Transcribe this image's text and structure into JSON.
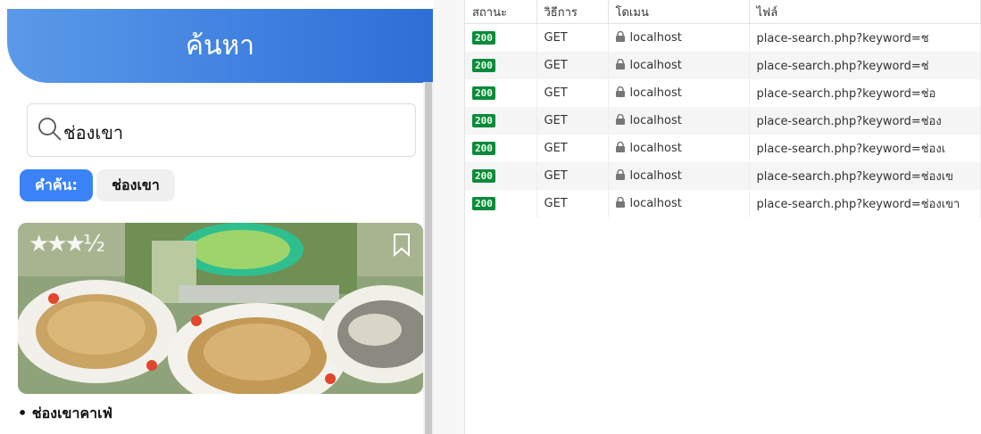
{
  "app": {
    "header_title": "ค้นหา",
    "search_value": "ช่องเขา",
    "chip_label": "คำค้น:",
    "chip_value": "ช่องเขา",
    "rating_stars": "★★★½",
    "place_name": "• ช่องเขาคาเฟ่"
  },
  "network": {
    "columns": [
      "สถานะ",
      "วิธีการ",
      "โดเมน",
      "ไฟล์"
    ],
    "rows": [
      {
        "status": "200",
        "method": "GET",
        "domain": "localhost",
        "file": "place-search.php?keyword=ช"
      },
      {
        "status": "200",
        "method": "GET",
        "domain": "localhost",
        "file": "place-search.php?keyword=ช่"
      },
      {
        "status": "200",
        "method": "GET",
        "domain": "localhost",
        "file": "place-search.php?keyword=ช่อ"
      },
      {
        "status": "200",
        "method": "GET",
        "domain": "localhost",
        "file": "place-search.php?keyword=ช่อง"
      },
      {
        "status": "200",
        "method": "GET",
        "domain": "localhost",
        "file": "place-search.php?keyword=ช่องเ"
      },
      {
        "status": "200",
        "method": "GET",
        "domain": "localhost",
        "file": "place-search.php?keyword=ช่องเข"
      },
      {
        "status": "200",
        "method": "GET",
        "domain": "localhost",
        "file": "place-search.php?keyword=ช่องเขา"
      }
    ]
  },
  "colors": {
    "header_blue": "#3f7fe0",
    "chip_blue": "#3b82f6",
    "status_green": "#0c8a3c"
  },
  "icons": {
    "search": "search-icon",
    "lock": "lock-icon",
    "bookmark": "bookmark-icon",
    "star": "star-icon"
  }
}
